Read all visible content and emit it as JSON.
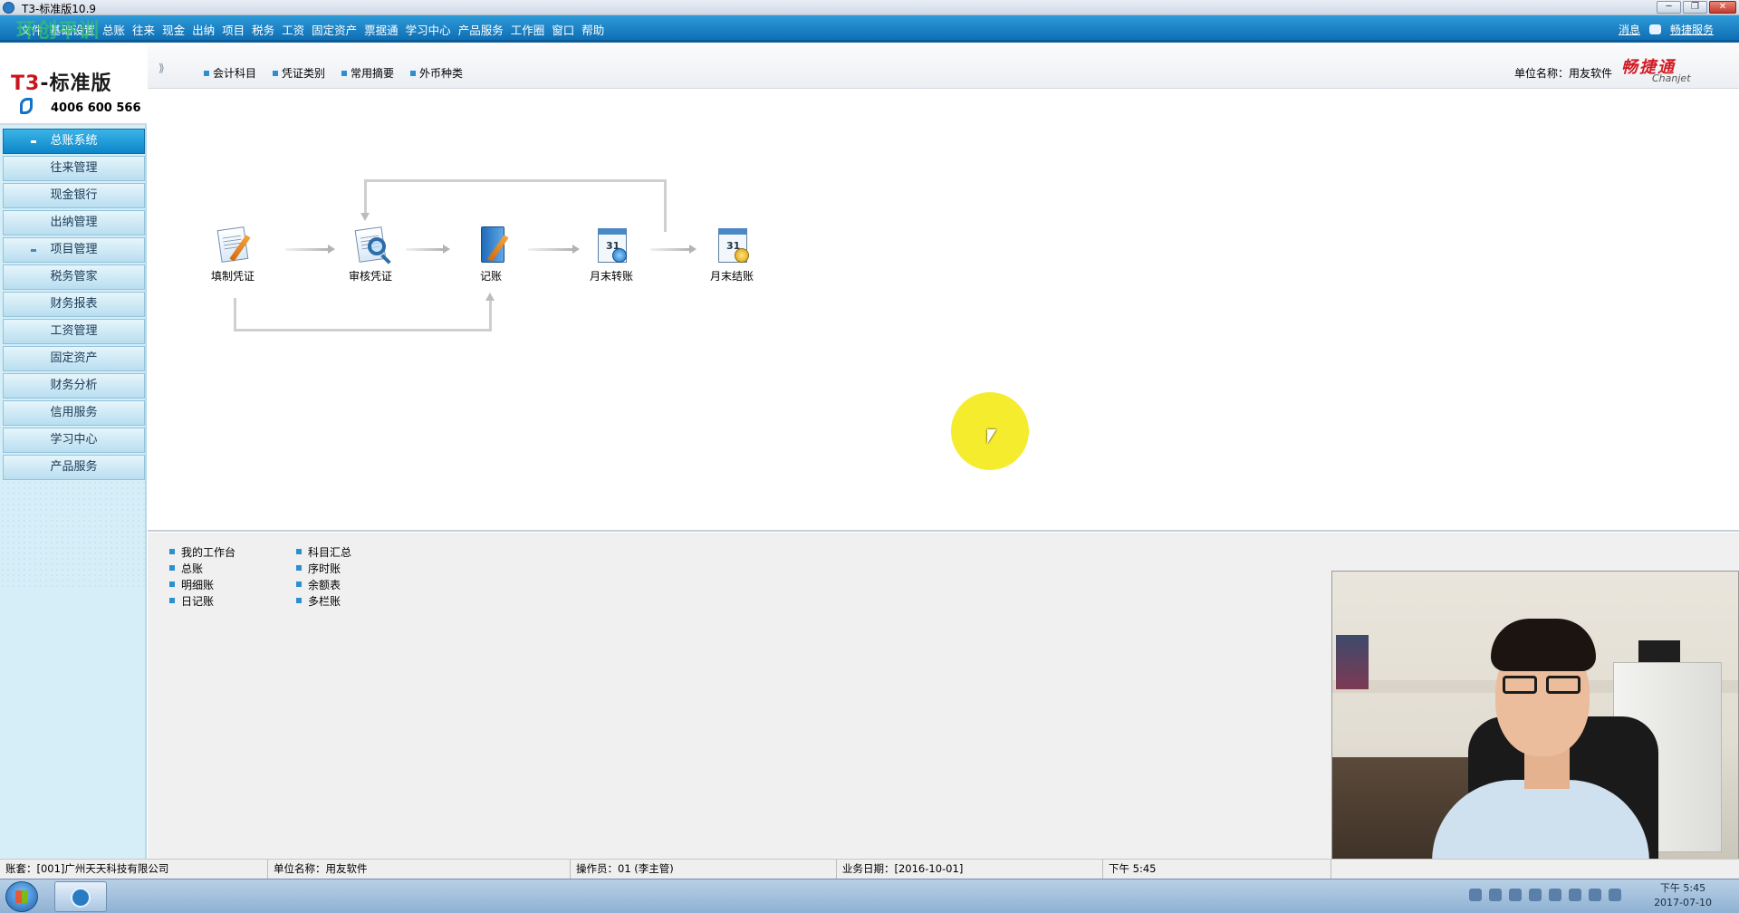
{
  "window": {
    "title": "T3-标准版10.9",
    "controls": [
      "─",
      "❐",
      "✕"
    ]
  },
  "menubar": {
    "watermark": "环创平训",
    "items": [
      "文件",
      "基础设置",
      "总账",
      "往来",
      "现金",
      "出纳",
      "项目",
      "税务",
      "工资",
      "固定资产",
      "票据通",
      "学习中心",
      "产品服务",
      "工作圈",
      "窗口",
      "帮助"
    ],
    "right_links": [
      "消息",
      "畅捷服务"
    ]
  },
  "logo": {
    "brand_prefix": "T3",
    "brand_suffix": "-标准版",
    "phone": "4006 600 566"
  },
  "sidebar": {
    "items": [
      {
        "label": "总账系统",
        "active": true,
        "bullet": true
      },
      {
        "label": "往来管理"
      },
      {
        "label": "现金银行"
      },
      {
        "label": "出纳管理"
      },
      {
        "label": "项目管理",
        "bullet": true
      },
      {
        "label": "税务管家"
      },
      {
        "label": "财务报表"
      },
      {
        "label": "工资管理"
      },
      {
        "label": "固定资产"
      },
      {
        "label": "财务分析"
      },
      {
        "label": "信用服务"
      },
      {
        "label": "学习中心"
      },
      {
        "label": "产品服务"
      }
    ]
  },
  "toolbar": {
    "collapse_glyph": "⟫",
    "tools": [
      "会计科目",
      "凭证类别",
      "常用摘要",
      "外币种类"
    ],
    "unit_label": "单位名称：用友软件",
    "brand_cn": "畅捷通",
    "brand_en": "Chanjet"
  },
  "flow": {
    "nodes": [
      "填制凭证",
      "审核凭证",
      "记账",
      "月末转账",
      "月末结账"
    ]
  },
  "quicklinks": {
    "col1": [
      "我的工作台",
      "总账",
      "明细账",
      "日记账"
    ],
    "col2": [
      "科目汇总",
      "序时账",
      "余额表",
      "多栏账"
    ]
  },
  "statusbar": {
    "account": "账套：[001]广州天天科技有限公司",
    "unit": "单位名称：用友软件",
    "operator": "操作员：01 (李主管)",
    "business_date": "业务日期：[2016-10-01]",
    "time": "下午 5:45"
  },
  "taskbar": {
    "clock_time": "下午 5:45",
    "clock_date": "2017-07-10"
  }
}
